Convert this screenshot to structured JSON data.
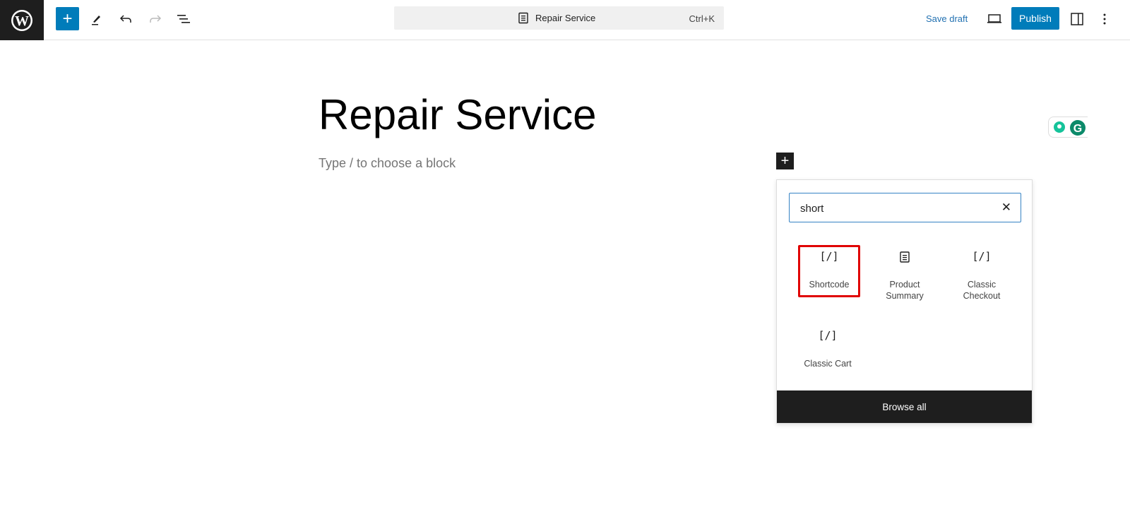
{
  "toolbar": {
    "add_icon": "plus-icon",
    "ctrl_k": "Ctrl+K",
    "doc_title": "Repair Service",
    "save_draft": "Save draft",
    "publish": "Publish",
    "accent": "#007cba"
  },
  "editor": {
    "title": "Repair Service",
    "placeholder": "Type / to choose a block"
  },
  "inserter": {
    "search_value": "short",
    "items": [
      {
        "label": "Shortcode",
        "icon": "[/]",
        "highlighted": true
      },
      {
        "label": "Product Summary",
        "icon": "document-icon"
      },
      {
        "label": "Classic Checkout",
        "icon": "[/]"
      },
      {
        "label": "Classic Cart",
        "icon": "[/]"
      }
    ],
    "browse_all": "Browse all",
    "highlight_color": "#e00000"
  }
}
